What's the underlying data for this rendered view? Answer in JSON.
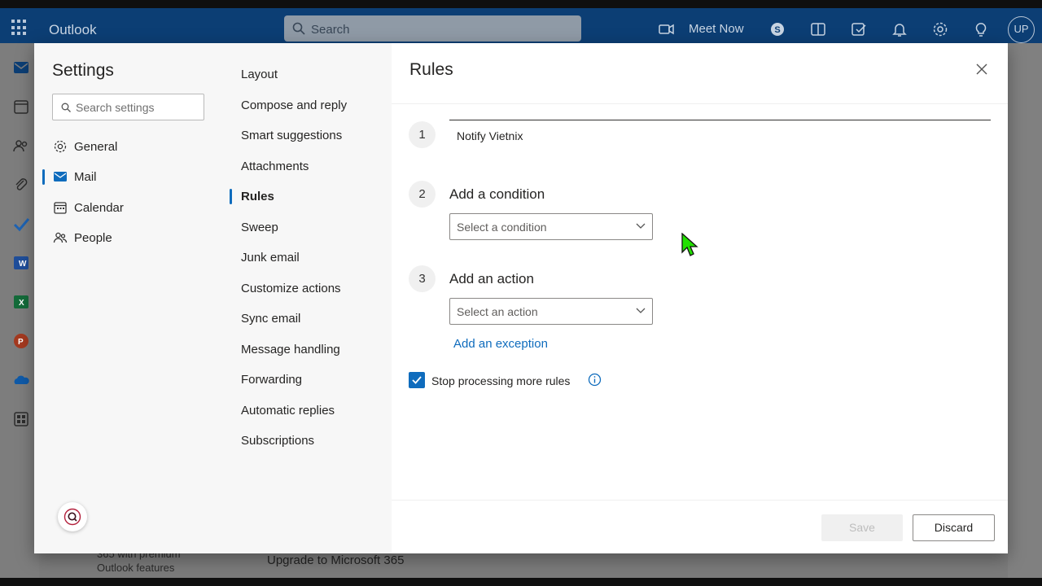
{
  "app": {
    "brand": "Outlook",
    "search_placeholder": "Search",
    "meet_now": "Meet Now",
    "avatar_initials": "UP"
  },
  "background": {
    "upgrade_text": "Upgrade to Microsoft 365",
    "premium_line1": "365 with premium",
    "premium_line2": "Outlook features"
  },
  "settings": {
    "title": "Settings",
    "search_placeholder": "Search settings",
    "categories": [
      {
        "label": "General",
        "icon": "gear-icon",
        "active": false
      },
      {
        "label": "Mail",
        "icon": "mail-icon",
        "active": true
      },
      {
        "label": "Calendar",
        "icon": "calendar-icon",
        "active": false
      },
      {
        "label": "People",
        "icon": "people-icon",
        "active": false
      }
    ],
    "mail_items": [
      {
        "label": "Layout",
        "active": false
      },
      {
        "label": "Compose and reply",
        "active": false
      },
      {
        "label": "Smart suggestions",
        "active": false
      },
      {
        "label": "Attachments",
        "active": false
      },
      {
        "label": "Rules",
        "active": true
      },
      {
        "label": "Sweep",
        "active": false
      },
      {
        "label": "Junk email",
        "active": false
      },
      {
        "label": "Customize actions",
        "active": false
      },
      {
        "label": "Sync email",
        "active": false
      },
      {
        "label": "Message handling",
        "active": false
      },
      {
        "label": "Forwarding",
        "active": false
      },
      {
        "label": "Automatic replies",
        "active": false
      },
      {
        "label": "Subscriptions",
        "active": false
      }
    ]
  },
  "rules": {
    "title": "Rules",
    "steps": [
      {
        "number": "1",
        "name_value": "Notify Vietnix"
      },
      {
        "number": "2",
        "label": "Add a condition",
        "placeholder": "Select a condition"
      },
      {
        "number": "3",
        "label": "Add an action",
        "placeholder": "Select an action"
      }
    ],
    "add_exception": "Add an exception",
    "stop_processing_label": "Stop processing more rules",
    "stop_processing_checked": true,
    "save_label": "Save",
    "discard_label": "Discard"
  },
  "colors": {
    "accent": "#0f6cbd",
    "topbar": "#0c3e74",
    "cursor": "#22e000"
  }
}
